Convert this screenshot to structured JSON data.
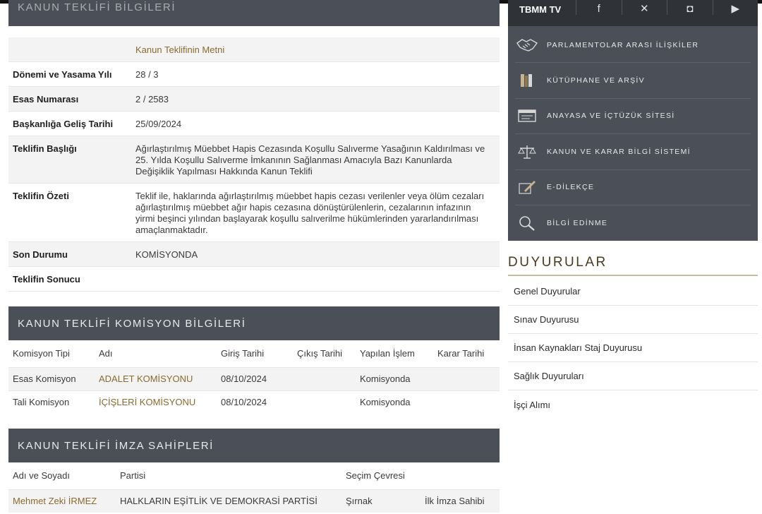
{
  "top_section": {
    "title": "KANUN TEKLİFİ BİLGİLERİ"
  },
  "info": {
    "text_link": "Kanun Teklifinin Metni",
    "rows": [
      {
        "label": "Dönemi ve Yasama Yılı",
        "value": "28 / 3"
      },
      {
        "label": "Esas Numarası",
        "value": "2 / 2583"
      },
      {
        "label": "Başkanlığa Geliş Tarihi",
        "value": "25/09/2024"
      },
      {
        "label": "Teklifin Başlığı",
        "value": "Ağırlaştırılmış Müebbet Hapis Cezasında Koşullu Salıverme Yasağının Kaldırılması ve 25. Yılda Koşullu Salıverme İmkanının Sağlanması Amacıyla Bazı Kanunlarda Değişiklik Yapılması Hakkında Kanun Teklifi"
      },
      {
        "label": "Teklifin Özeti",
        "value": "Teklif ile, haklarında ağırlaştırılmış müebbet hapis cezası verilenler veya ölüm cezaları ağırlaştırılmış müebbet ağır hapis cezasına dönüştürülenlerin, cezalarının infazının yirmi beşinci yılından başlayarak koşullu salıverilme hükümlerinden yararlandırılması amaçlanmaktadır."
      },
      {
        "label": "Son Durumu",
        "value": "KOMİSYONDA"
      },
      {
        "label": "Teklifin Sonucu",
        "value": ""
      }
    ]
  },
  "commission": {
    "title": "KANUN TEKLİFİ KOMİSYON BİLGİLERİ",
    "headers": [
      "Komisyon Tipi",
      "Adı",
      "Giriş Tarihi",
      "Çıkış Tarihi",
      "Yapılan İşlem",
      "Karar Tarihi"
    ],
    "rows": [
      [
        "Esas Komisyon",
        "ADALET KOMİSYONU",
        "08/10/2024",
        "",
        "Komisyonda",
        ""
      ],
      [
        "Tali Komisyon",
        "İÇİŞLERİ KOMİSYONU",
        "08/10/2024",
        "",
        "Komisyonda",
        ""
      ]
    ]
  },
  "signatures": {
    "title": "KANUN TEKLİFİ İMZA SAHİPLERİ",
    "headers": [
      "Adı ve Soyadı",
      "Partisi",
      "Seçim Çevresi",
      ""
    ],
    "rows": [
      [
        "Mehmet Zeki İRMEZ",
        "HALKLARIN EŞİTLİK VE DEMOKRASİ PARTİSİ",
        "Şırnak",
        "İlk İmza Sahibi"
      ]
    ]
  },
  "sidebar": {
    "media_label": "TBMM TV",
    "social_icons": [
      "facebook-icon",
      "x-icon",
      "instagram-icon",
      "youtube-icon"
    ],
    "links": [
      {
        "label": "PARLAMENTOLAR ARASI İLİŞKİLER",
        "icon": "handshake-icon"
      },
      {
        "label": "KÜTÜPHANE VE ARŞİV",
        "icon": "books-icon"
      },
      {
        "label": "ANAYASA VE İÇTÜZÜK SİTESİ",
        "icon": "browser-icon"
      },
      {
        "label": "KANUN VE KARAR BİLGİ SİSTEMİ",
        "icon": "scales-icon"
      },
      {
        "label": "E-DİLEKÇE",
        "icon": "feather-pen-icon"
      },
      {
        "label": "BİLGİ EDİNME",
        "icon": "magnifier-icon"
      }
    ]
  },
  "announcements": {
    "title": "DUYURULAR",
    "items": [
      "Genel Duyurular",
      "Sınav Duyurusu",
      "İnsan Kaynakları Staj Duyurusu",
      "Sağlık Duyuruları",
      "İşçi Alımı"
    ]
  },
  "colors": {
    "panel": "#4b4f57",
    "link": "#8a6a2e",
    "row_shade": "#f3f3f3"
  }
}
